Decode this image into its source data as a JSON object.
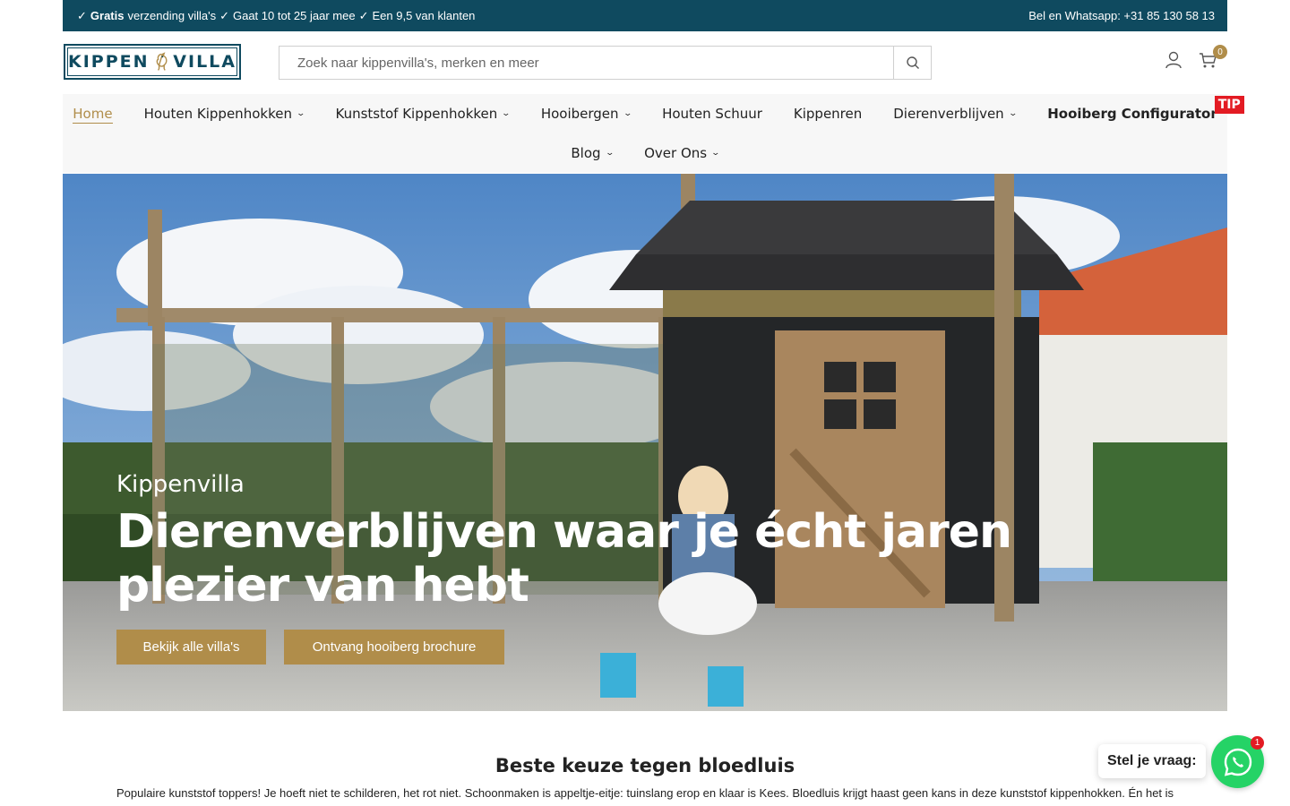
{
  "topbar": {
    "usps": [
      {
        "check": "✓",
        "bold": "Gratis",
        "text": "verzending villa's"
      },
      {
        "check": "✓",
        "bold": "",
        "text": "Gaat 10 tot 25 jaar mee"
      },
      {
        "check": "✓",
        "bold": "",
        "text": "Een 9,5 van klanten"
      }
    ],
    "contact": "Bel en Whatsapp: +31 85 130 58 13"
  },
  "header": {
    "logo_left": "KIPPEN",
    "logo_right": "VILLA",
    "search_placeholder": "Zoek naar kippenvilla's, merken en meer",
    "cart_count": "0"
  },
  "nav": {
    "row1": [
      {
        "label": "Home",
        "dropdown": false,
        "active": true
      },
      {
        "label": "Houten Kippenhokken",
        "dropdown": true
      },
      {
        "label": "Kunststof Kippenhokken",
        "dropdown": true
      },
      {
        "label": "Hooibergen",
        "dropdown": true
      },
      {
        "label": "Houten Schuur",
        "dropdown": false
      },
      {
        "label": "Kippenren",
        "dropdown": false
      },
      {
        "label": "Dierenverblijven",
        "dropdown": true
      },
      {
        "label": "Hooiberg Configurator",
        "dropdown": false,
        "bold": true,
        "badge": "TIP"
      }
    ],
    "row2": [
      {
        "label": "Blog",
        "dropdown": true
      },
      {
        "label": "Over Ons",
        "dropdown": true
      }
    ]
  },
  "hero": {
    "subtitle": "Kippenvilla",
    "title": "Dierenverblijven waar je écht jaren plezier van hebt",
    "button_primary": "Bekijk alle villa's",
    "button_secondary": "Ontvang hooiberg brochure"
  },
  "section": {
    "title": "Beste keuze tegen bloedluis",
    "text": "Populaire kunststof toppers! Je hoeft niet te schilderen, het rot niet. Schoonmaken is appeltje-eitje: tuinslang erop en klaar is Kees. Bloedluis krijgt haast geen kans in deze kunststof kippenhokken. Én het is"
  },
  "chat": {
    "prompt": "Stel je vraag:",
    "count": "1"
  },
  "colors": {
    "topbar": "#0f4a5f",
    "accent": "#b08d4a",
    "badge": "#e31b23",
    "whatsapp": "#25d366"
  }
}
